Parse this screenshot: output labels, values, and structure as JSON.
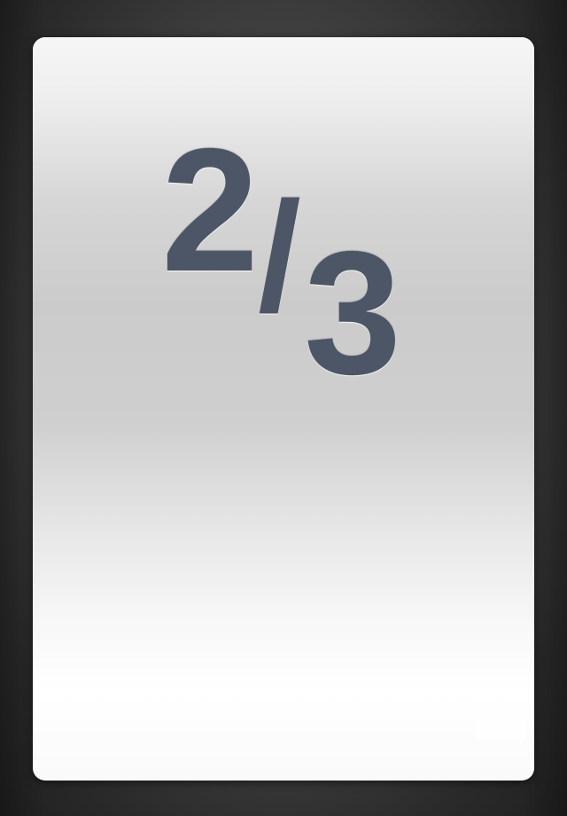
{
  "card": {
    "fraction": {
      "numerator": "2",
      "separator": "/",
      "denominator": "3"
    }
  },
  "colors": {
    "background": "#3a3a3a",
    "card_top": "#f6f6f6",
    "card_middle": "#cbcbcb",
    "card_bottom": "#ffffff",
    "text": "#4d5666"
  }
}
